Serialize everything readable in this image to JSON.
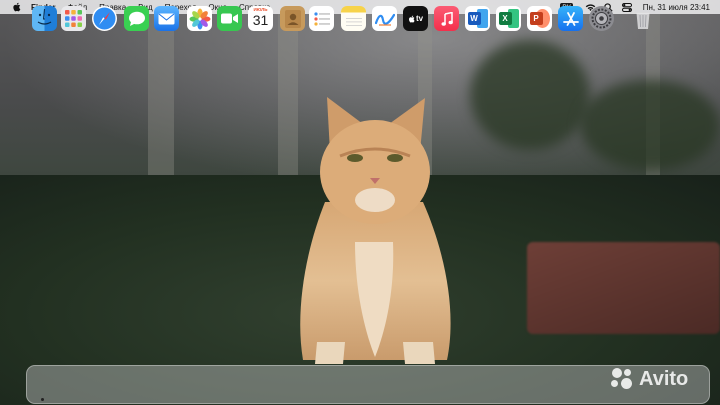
{
  "menubar": {
    "app_name": "Finder",
    "items": [
      "Файл",
      "Правка",
      "Вид",
      "Переход",
      "Окно",
      "Справка"
    ],
    "input_source": "РУ",
    "clock": "Пн, 31 июля  23:41"
  },
  "dock": {
    "apps": [
      {
        "name": "Finder",
        "icon": "finder-icon"
      },
      {
        "name": "Launchpad",
        "icon": "launchpad-icon"
      },
      {
        "name": "Safari",
        "icon": "safari-icon"
      },
      {
        "name": "Messages",
        "icon": "messages-icon"
      },
      {
        "name": "Mail",
        "icon": "mail-icon"
      },
      {
        "name": "Photos",
        "icon": "photos-icon"
      },
      {
        "name": "FaceTime",
        "icon": "facetime-icon"
      },
      {
        "name": "Calendar",
        "icon": "calendar-icon",
        "month": "ИЮЛЬ",
        "day": "31"
      },
      {
        "name": "Contacts",
        "icon": "contacts-icon"
      },
      {
        "name": "Reminders",
        "icon": "reminders-icon"
      },
      {
        "name": "Notes",
        "icon": "notes-icon"
      },
      {
        "name": "Freeform",
        "icon": "freeform-icon"
      },
      {
        "name": "TV",
        "icon": "tv-icon",
        "label": "tv"
      },
      {
        "name": "Music",
        "icon": "music-icon"
      },
      {
        "name": "Word",
        "icon": "word-icon",
        "label": "W"
      },
      {
        "name": "Excel",
        "icon": "excel-icon",
        "label": "X"
      },
      {
        "name": "PowerPoint",
        "icon": "powerpoint-icon",
        "label": "P"
      },
      {
        "name": "App Store",
        "icon": "app-store-icon"
      },
      {
        "name": "System Settings",
        "icon": "settings-icon"
      },
      {
        "name": "Trash",
        "icon": "trash-icon"
      }
    ]
  },
  "watermark": {
    "text": "Avito"
  },
  "colors": {
    "menubar_bg": "#ececee",
    "dock_bg": "#cdcdd0"
  }
}
